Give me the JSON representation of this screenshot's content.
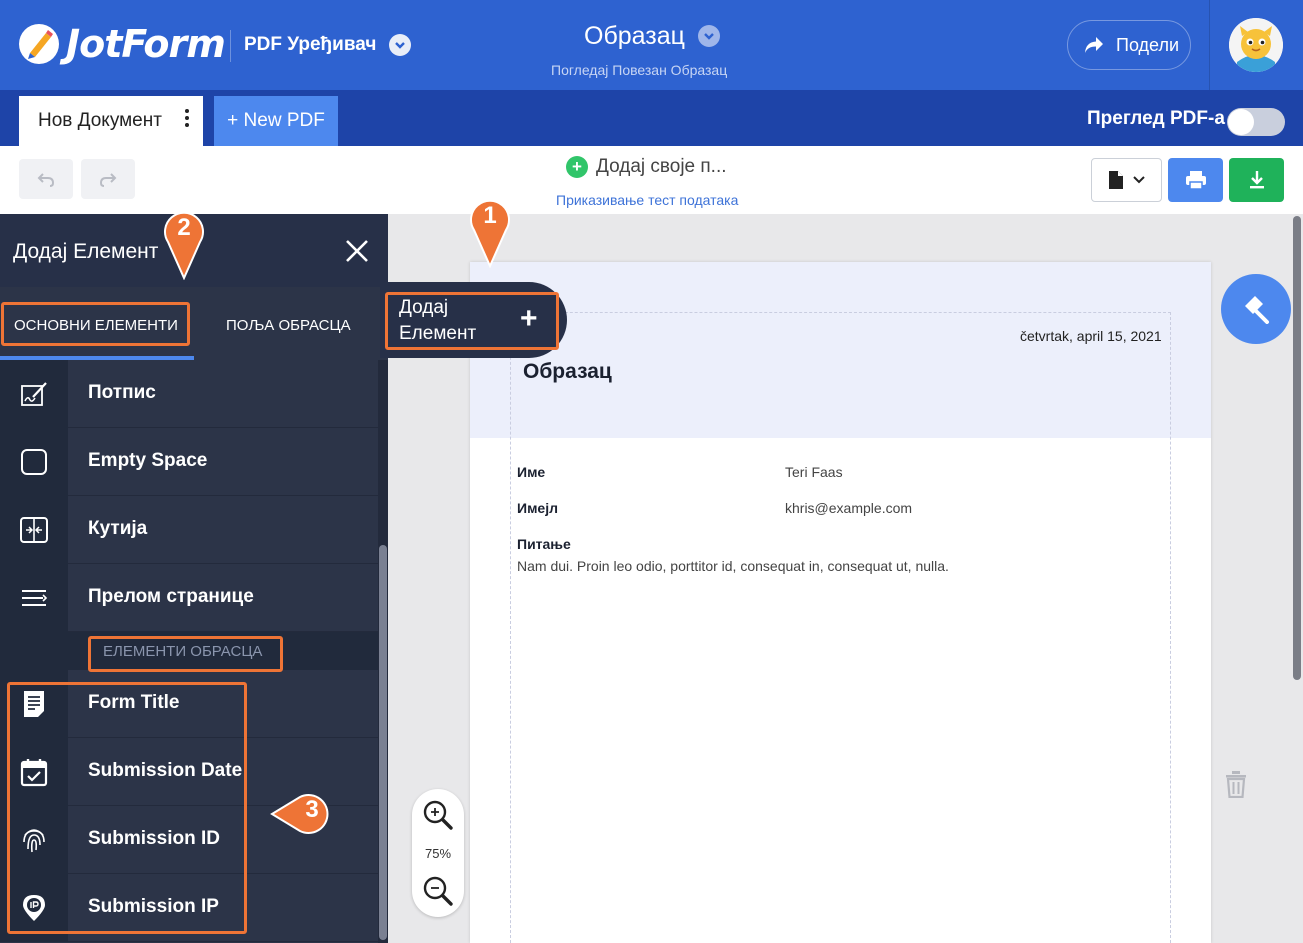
{
  "header": {
    "logo_text": "JotForm",
    "app_name": "PDF Уређивач",
    "form_title": "Образац",
    "form_subtitle": "Погледај Повезан Образац",
    "share_label": "Подели"
  },
  "tabs": {
    "doc_tab": "Нов Документ",
    "new_pdf": "+ New PDF",
    "preview_label": "Преглед PDF-а",
    "preview_on": false
  },
  "toolbar": {
    "add_yours": "Додај своје п...",
    "test_data": "Приказивање тест података"
  },
  "panel": {
    "title": "Додај Елемент",
    "tabs": [
      "ОСНОВНИ ЕЛЕМЕНТИ",
      "ПОЉА ОБРАСЦА"
    ],
    "items": [
      {
        "label": "Потпис",
        "icon": "signature-icon"
      },
      {
        "label": "Empty Space",
        "icon": "empty-square-icon"
      },
      {
        "label": "Кутија",
        "icon": "box-icon"
      },
      {
        "label": "Прелом странице",
        "icon": "page-break-icon"
      }
    ],
    "section_label": "ЕЛЕМЕНТИ ОБРАСЦА",
    "form_items": [
      {
        "label": "Form Title",
        "icon": "document-icon"
      },
      {
        "label": "Submission Date",
        "icon": "calendar-icon"
      },
      {
        "label": "Submission ID",
        "icon": "fingerprint-icon"
      },
      {
        "label": "Submission IP",
        "icon": "ip-pin-icon"
      }
    ]
  },
  "add_element_pill": {
    "label": "Додај Елемент"
  },
  "document": {
    "date": "četvrtak, april 15, 2021",
    "title": "Образац",
    "fields": [
      {
        "label": "Име",
        "value": "Teri Faas"
      },
      {
        "label": "Имејл",
        "value": "khris@example.com"
      }
    ],
    "question_label": "Питање",
    "question_text": "Nam dui. Proin leo odio, porttitor id, consequat in, consequat ut, nulla."
  },
  "zoom": {
    "level": "75%"
  },
  "annotations": [
    "1",
    "2",
    "3"
  ],
  "colors": {
    "brand_blue": "#2e62d0",
    "tab_blue": "#1e44a8",
    "panel_bg": "#2c3448",
    "accent_blue": "#4d88ee",
    "success_green": "#1fb25a",
    "annotation_orange": "#ee7436"
  }
}
